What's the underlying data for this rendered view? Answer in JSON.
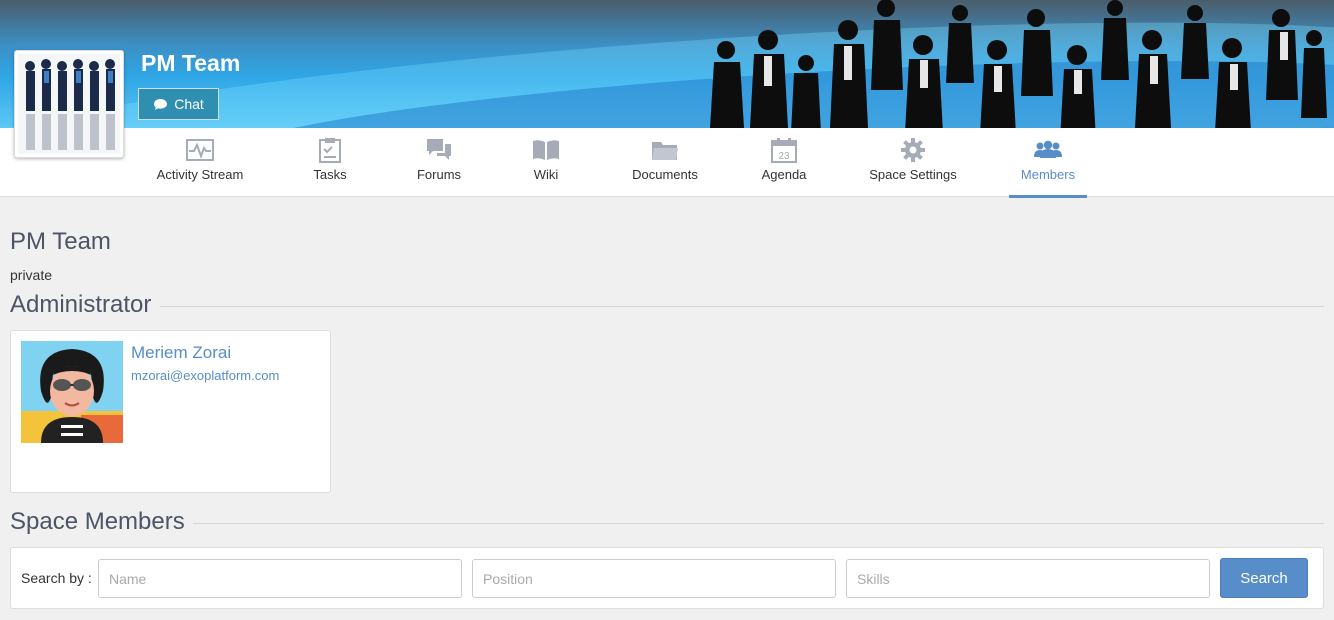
{
  "space": {
    "name": "PM Team",
    "chat_label": "Chat"
  },
  "nav": {
    "items": [
      {
        "label": "Activity Stream",
        "icon": "activity-stream-icon"
      },
      {
        "label": "Tasks",
        "icon": "tasks-icon"
      },
      {
        "label": "Forums",
        "icon": "forums-icon"
      },
      {
        "label": "Wiki",
        "icon": "wiki-icon"
      },
      {
        "label": "Documents",
        "icon": "documents-icon"
      },
      {
        "label": "Agenda",
        "icon": "agenda-icon"
      },
      {
        "label": "Space Settings",
        "icon": "settings-icon"
      },
      {
        "label": "Members",
        "icon": "members-icon"
      }
    ],
    "active": "Members",
    "agenda_day": "23"
  },
  "main": {
    "title": "PM Team",
    "privacy": "private",
    "administrator_heading": "Administrator",
    "admin": {
      "name": "Meriem Zorai",
      "email": "mzorai@exoplatform.com"
    },
    "members_heading": "Space Members",
    "search": {
      "by_label": "Search by :",
      "name_placeholder": "Name",
      "position_placeholder": "Position",
      "skills_placeholder": "Skills",
      "button_label": "Search"
    }
  },
  "colors": {
    "accent": "#578dc9",
    "title": "#4d5466",
    "nav_icon": "#a5acb8",
    "chat_button": "#2f8fb0"
  }
}
